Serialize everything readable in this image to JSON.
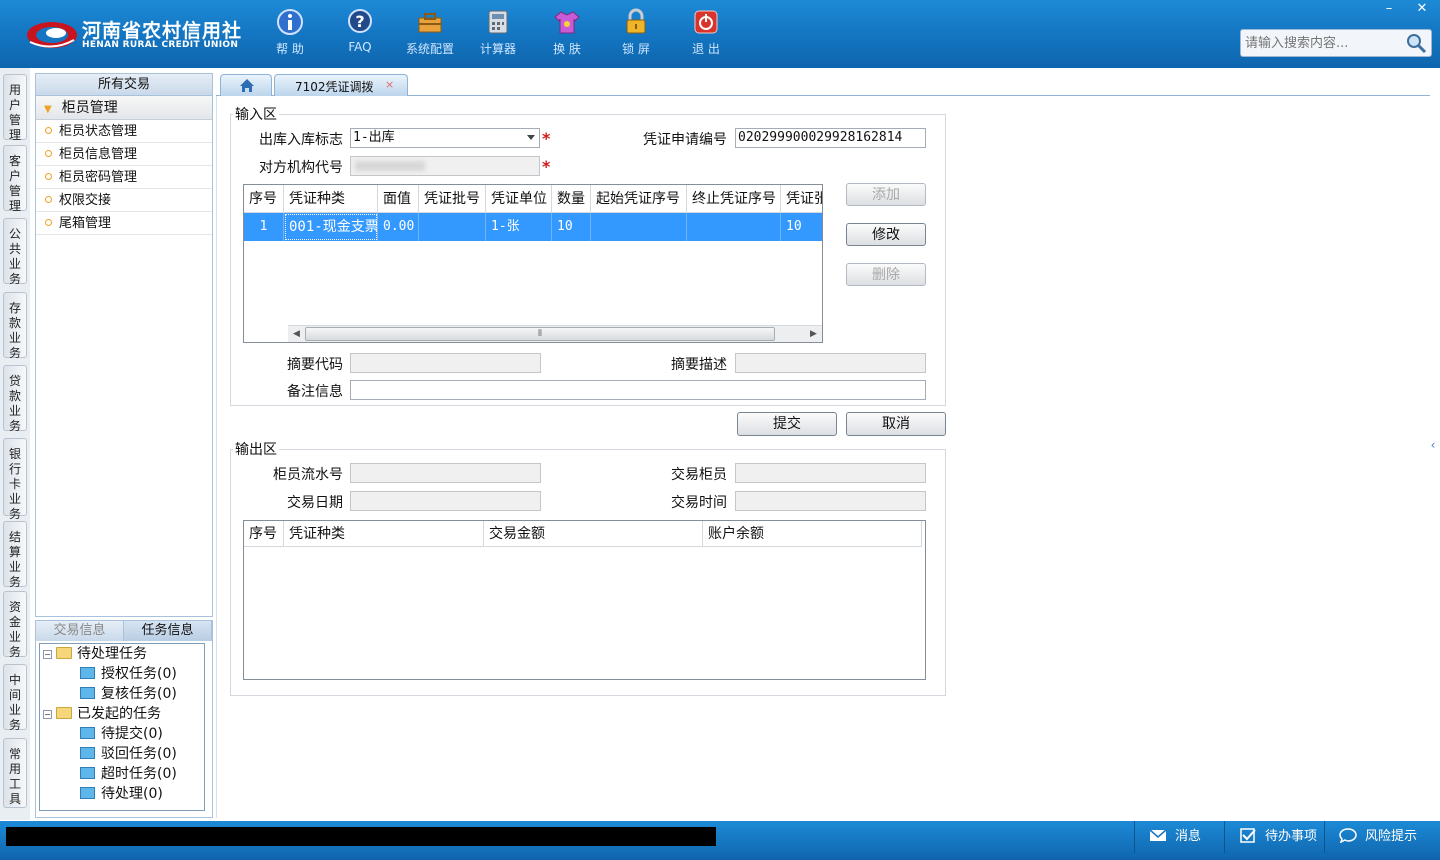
{
  "header": {
    "logo_cn": "河南省农村信用社",
    "logo_en": "HENAN RURAL CREDIT UNION",
    "tools": [
      {
        "label": "帮 助",
        "icon": "info-icon"
      },
      {
        "label": "FAQ",
        "icon": "faq-icon"
      },
      {
        "label": "系统配置",
        "icon": "toolbox-icon"
      },
      {
        "label": "计算器",
        "icon": "calculator-icon"
      },
      {
        "label": "换 肤",
        "icon": "shirt-icon"
      },
      {
        "label": "锁 屏",
        "icon": "lock-icon"
      },
      {
        "label": "退 出",
        "icon": "power-icon"
      }
    ],
    "minimize": "–",
    "close": "✕",
    "search_placeholder": "请输入搜索内容..."
  },
  "vtabs": [
    "用户管理",
    "客户管理",
    "公共业务",
    "存款业务",
    "贷款业务",
    "银行卡业务",
    "结算业务",
    "资金业务",
    "中间业务",
    "常用工具"
  ],
  "menu": {
    "title": "所有交易",
    "group": "柜员管理",
    "items": [
      "柜员状态管理",
      "柜员信息管理",
      "柜员密码管理",
      "权限交接",
      "尾箱管理"
    ]
  },
  "task_panel": {
    "tabs": [
      "交易信息",
      "任务信息"
    ],
    "tree": [
      {
        "label": "待处理任务",
        "level": 0
      },
      {
        "label": "授权任务(0)",
        "level": 1
      },
      {
        "label": "复核任务(0)",
        "level": 1
      },
      {
        "label": "已发起的任务",
        "level": 0
      },
      {
        "label": "待提交(0)",
        "level": 1
      },
      {
        "label": "驳回任务(0)",
        "level": 1
      },
      {
        "label": "超时任务(0)",
        "level": 1
      },
      {
        "label": "待处理(0)",
        "level": 1
      }
    ]
  },
  "tabs": {
    "home_icon": "home-icon",
    "active_tab": "7102凭证调拨",
    "close": "×"
  },
  "input_region": {
    "title": "输入区",
    "io_flag_label": "出库入库标志",
    "io_flag_value": "1-出库",
    "voucher_apply_no_label": "凭证申请编号",
    "voucher_apply_no_value": "020299900029928162814",
    "counterpart_org_label": "对方机构代号",
    "required_mark": "*",
    "grid": {
      "columns": [
        "序号",
        "凭证种类",
        "面值",
        "凭证批号",
        "凭证单位",
        "数量",
        "起始凭证序号",
        "终止凭证序号",
        "凭证张"
      ],
      "rows": [
        [
          "1",
          "001-现金支票",
          "0.00",
          "",
          "1-张",
          "10",
          "",
          "",
          "10"
        ]
      ]
    },
    "add_button": "添加",
    "modify_button": "修改",
    "delete_button": "删除",
    "summary_code_label": "摘要代码",
    "summary_desc_label": "摘要描述",
    "remark_label": "备注信息"
  },
  "actions": {
    "submit": "提交",
    "cancel": "取消"
  },
  "output_region": {
    "title": "输出区",
    "teller_serial_label": "柜员流水号",
    "trade_teller_label": "交易柜员",
    "trade_date_label": "交易日期",
    "trade_time_label": "交易时间",
    "grid_columns": [
      "序号",
      "凭证种类",
      "交易金额",
      "账户余额"
    ]
  },
  "statusbar": {
    "message": "消息",
    "todo": "待办事项",
    "risk": "风险提示"
  }
}
